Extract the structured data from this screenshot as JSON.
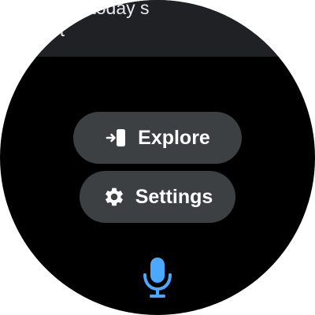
{
  "suggestion": {
    "text": "w me today s\nlist"
  },
  "actions": {
    "explore_label": "Explore",
    "settings_label": "Settings"
  },
  "icons": {
    "explore": "enter-device-icon",
    "settings": "gear-icon",
    "mic": "microphone-icon"
  },
  "colors": {
    "background": "#000000",
    "chip": "#3c4043",
    "card": "#202124",
    "mic_accent": "#4aa8ff"
  }
}
